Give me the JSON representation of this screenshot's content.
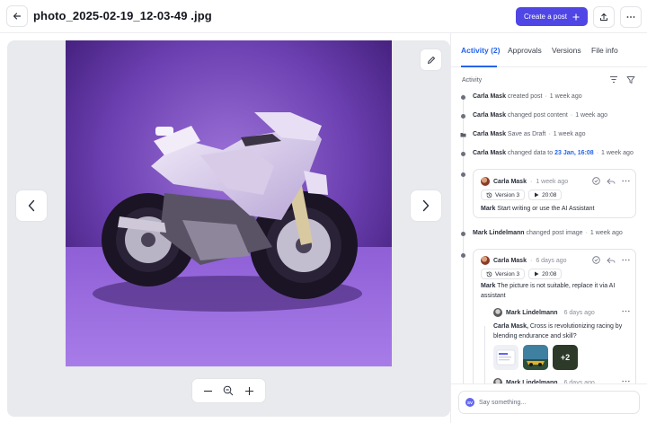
{
  "header": {
    "title": "photo_2025-02-19_12-03-49 .jpg",
    "create_label": "Create a post",
    "create_icon": "plus-icon"
  },
  "viewer": {
    "image": "purple-sport-motorcycle-photo",
    "zoom_tools": [
      "zoom-out-icon",
      "zoom-reset-icon",
      "zoom-in-icon"
    ]
  },
  "tabs": [
    {
      "label": "Activity (2)",
      "active": true
    },
    {
      "label": "Approvals",
      "active": false
    },
    {
      "label": "Versions",
      "active": false
    },
    {
      "label": "File info",
      "active": false
    }
  ],
  "activity": {
    "section_label": "Activity",
    "items": [
      {
        "user": "Carla Mask",
        "action": "created post",
        "time": "1 week ago"
      },
      {
        "user": "Carla Mask",
        "action": "changed post content",
        "time": "1 week ago"
      },
      {
        "user": "Carla Mask",
        "action": "Save as Draft",
        "time": "1 week ago"
      },
      {
        "user": "Carla Mask",
        "action": "changed data to",
        "link": "23 Jan, 16:08",
        "time": "1 week ago"
      },
      {
        "user": "Mark Lindelmann",
        "action": "changed post image",
        "time": "1 week ago"
      }
    ],
    "comment1": {
      "user": "Carla Mask",
      "time": "1 week ago",
      "version": "Version 3",
      "timestamp": "20:08",
      "mention": "Mark",
      "text": "Start writing or use the AI Assistant"
    },
    "comment2": {
      "user": "Carla Mask",
      "time": "6 days ago",
      "version": "Version 3",
      "timestamp": "20:08",
      "mention": "Mark",
      "text": "The picture is not suitable, replace it via AI assistant"
    },
    "reply1": {
      "user": "Mark Lindelmann",
      "time": "6 days ago",
      "mention": "Carla Mask,",
      "text": "Cross is revolutionizing racing by blending endurance and skill?",
      "more_count": "+2"
    },
    "reply2": {
      "user": "Mark Lindelmann",
      "time": "6 days ago"
    }
  },
  "composer": {
    "avatar_initials": "SV",
    "placeholder": "Say something..."
  }
}
